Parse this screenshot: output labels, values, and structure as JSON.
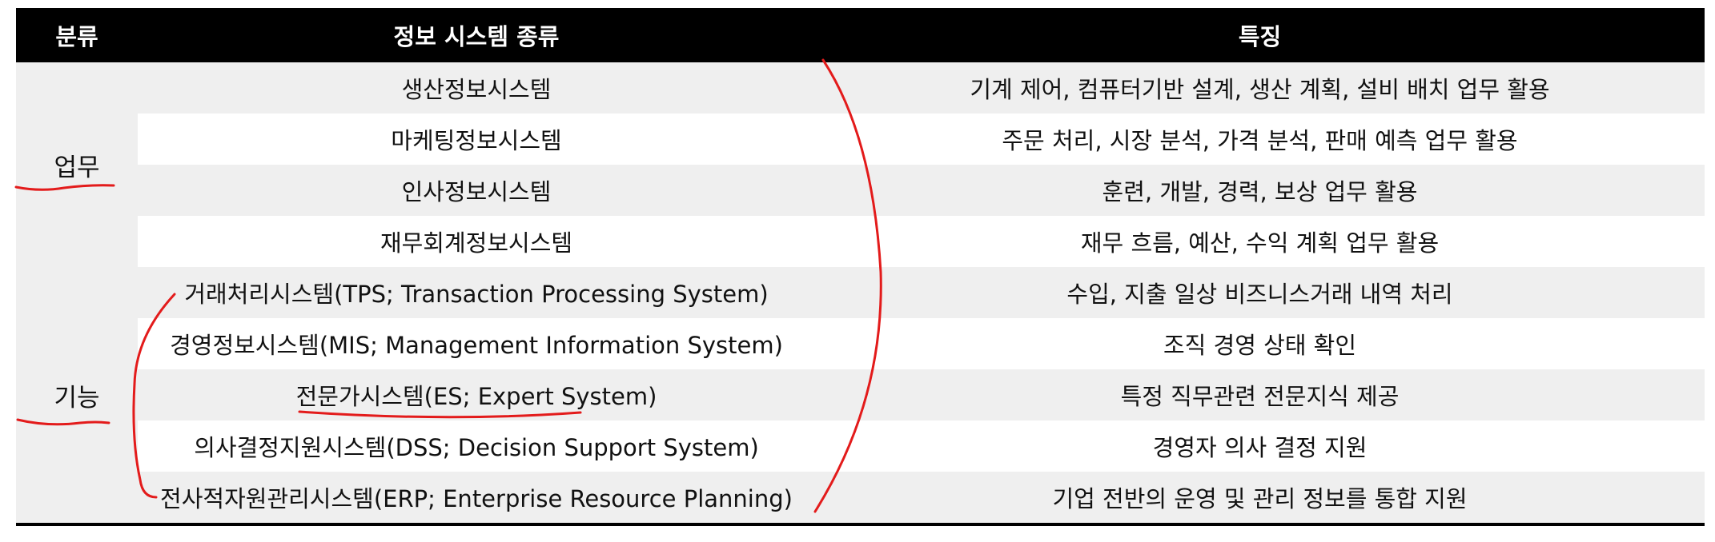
{
  "table": {
    "headers": [
      "분류",
      "정보 시스템 종류",
      "특징"
    ],
    "categories": {
      "work": "업무",
      "function": "기능"
    },
    "rows": [
      {
        "system": "생산정보시스템",
        "feature": "기계 제어, 컴퓨터기반 설계, 생산 계획, 설비 배치 업무 활용"
      },
      {
        "system": "마케팅정보시스템",
        "feature": "주문 처리, 시장 분석, 가격 분석, 판매 예측 업무 활용"
      },
      {
        "system": "인사정보시스템",
        "feature": "훈련, 개발, 경력, 보상 업무 활용"
      },
      {
        "system": "재무회계정보시스템",
        "feature": "재무 흐름, 예산, 수익 계획 업무 활용"
      },
      {
        "system": "거래처리시스템(TPS; Transaction Processing System)",
        "feature": "수입, 지출 일상 비즈니스거래 내역 처리"
      },
      {
        "system": "경영정보시스템(MIS; Management Information System)",
        "feature": "조직 경영 상태 확인"
      },
      {
        "system": "전문가시스템(ES; Expert System)",
        "feature": "특정 직무관련 전문지식 제공"
      },
      {
        "system": "의사결정지원시스템(DSS; Decision Support System)",
        "feature": "경영자 의사 결정 지원"
      },
      {
        "system": "전사적자원관리시스템(ERP; Enterprise Resource Planning)",
        "feature": "기업 전반의 운영 및 관리 정보를 통합 지원"
      }
    ]
  },
  "annotation_color": "#e31b1b"
}
